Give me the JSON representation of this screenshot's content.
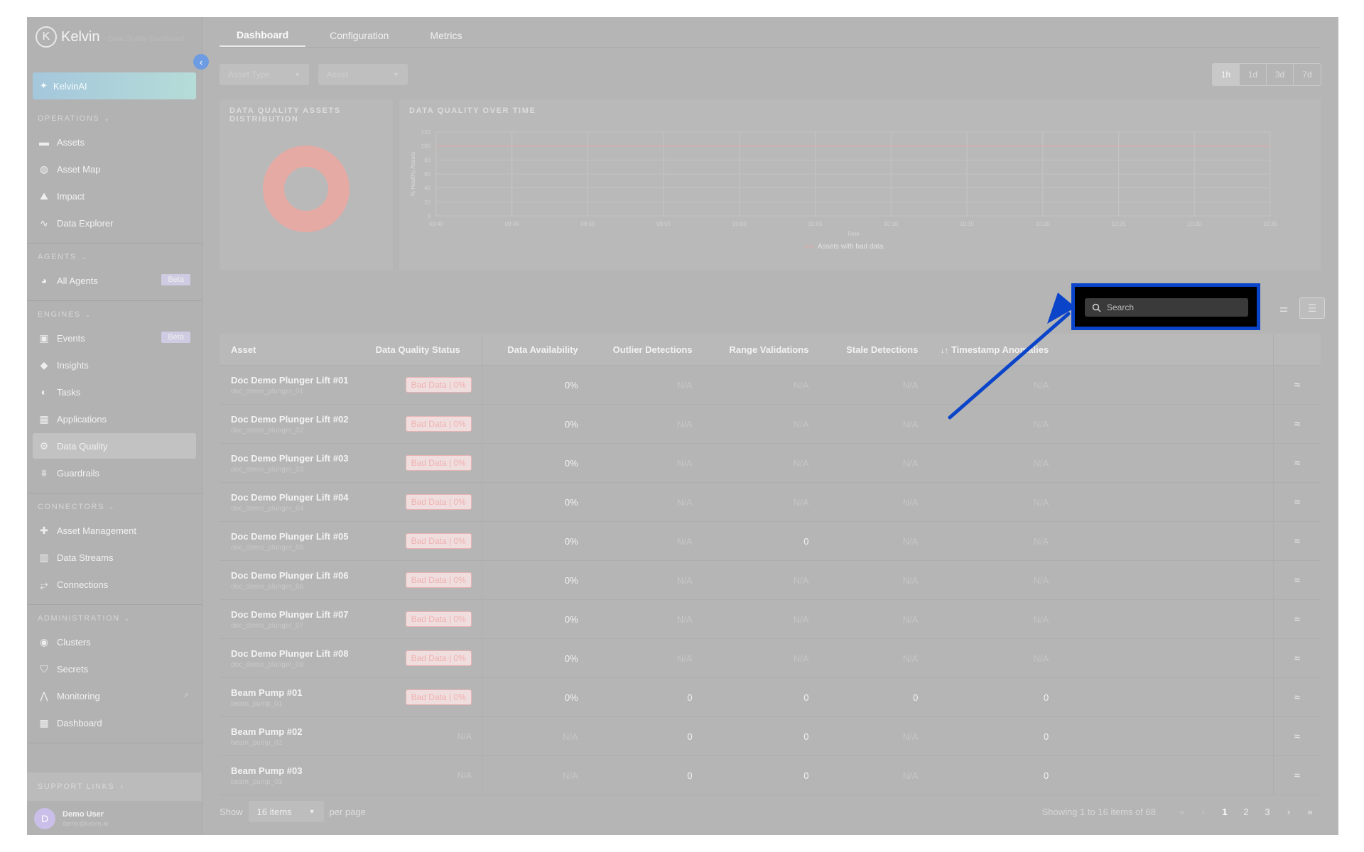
{
  "brand": {
    "name": "Kelvin",
    "subtitle": "Data Quality Dashboard",
    "logo_letter": "K"
  },
  "kelvinai": {
    "label": "KelvinAI"
  },
  "sidebar": {
    "sections": [
      {
        "title": "OPERATIONS",
        "items": [
          {
            "label": "Assets",
            "icon": "assets-icon"
          },
          {
            "label": "Asset Map",
            "icon": "globe-icon"
          },
          {
            "label": "Impact",
            "icon": "impact-icon"
          },
          {
            "label": "Data Explorer",
            "icon": "pulse-icon"
          }
        ]
      },
      {
        "title": "AGENTS",
        "items": [
          {
            "label": "All Agents",
            "icon": "agents-icon",
            "badge": "Beta"
          }
        ]
      },
      {
        "title": "ENGINES",
        "items": [
          {
            "label": "Events",
            "icon": "events-icon",
            "badge": "Beta"
          },
          {
            "label": "Insights",
            "icon": "tag-icon"
          },
          {
            "label": "Tasks",
            "icon": "tasks-icon"
          },
          {
            "label": "Applications",
            "icon": "grid-icon"
          },
          {
            "label": "Data Quality",
            "icon": "gear-icon",
            "active": true
          },
          {
            "label": "Guardrails",
            "icon": "guardrails-icon"
          }
        ]
      },
      {
        "title": "CONNECTORS",
        "items": [
          {
            "label": "Asset Management",
            "icon": "asset-management-icon"
          },
          {
            "label": "Data Streams",
            "icon": "chart-icon"
          },
          {
            "label": "Connections",
            "icon": "connections-icon"
          }
        ]
      },
      {
        "title": "ADMINISTRATION",
        "items": [
          {
            "label": "Clusters",
            "icon": "clusters-icon"
          },
          {
            "label": "Secrets",
            "icon": "shield-icon"
          },
          {
            "label": "Monitoring",
            "icon": "monitoring-icon",
            "external": true
          },
          {
            "label": "Dashboard",
            "icon": "dashboard-icon"
          }
        ]
      }
    ],
    "support_links": "SUPPORT LINKS"
  },
  "user": {
    "initial": "D",
    "name": "Demo User",
    "email": "demo@kelvin.ai"
  },
  "tabs": [
    {
      "label": "Dashboard",
      "active": true
    },
    {
      "label": "Configuration"
    },
    {
      "label": "Metrics"
    }
  ],
  "filters": {
    "asset_type": "Asset Type",
    "asset": "Asset"
  },
  "time_ranges": [
    {
      "label": "1h",
      "active": true
    },
    {
      "label": "1d"
    },
    {
      "label": "3d"
    },
    {
      "label": "7d"
    }
  ],
  "cards": {
    "distribution_title": "DATA QUALITY ASSETS DISTRIBUTION",
    "over_time_title": "DATA QUALITY OVER TIME"
  },
  "chart_data": [
    {
      "type": "pie",
      "title": "DATA QUALITY ASSETS DISTRIBUTION",
      "categories": [
        ""
      ],
      "values": [
        100
      ],
      "colors": [
        "#e6aaa5"
      ]
    },
    {
      "type": "line",
      "title": "DATA QUALITY OVER TIME",
      "xlabel": "Time",
      "ylabel": "% Healthy Assets",
      "x": [
        "09:40",
        "09:45",
        "09:50",
        "09:55",
        "10:00",
        "10:05",
        "10:10",
        "10:15",
        "10:20",
        "10:25",
        "10:30",
        "10:35"
      ],
      "yticks": [
        0,
        20,
        40,
        60,
        80,
        100,
        120
      ],
      "ylim": [
        0,
        120
      ],
      "grid": true,
      "legend": "bottom",
      "series": [
        {
          "name": "Assets with bad data",
          "color": "#dda6a6",
          "values": [
            100,
            100,
            100,
            100,
            100,
            100,
            100,
            100,
            100,
            100,
            100,
            100
          ]
        }
      ]
    }
  ],
  "search": {
    "placeholder": "Search"
  },
  "table": {
    "columns": [
      "Asset",
      "Data Quality Status",
      "Data Availability",
      "Outlier Detections",
      "Range Validations",
      "Stale Detections",
      "Timestamp Anomalies"
    ],
    "sort_icon": "↓↑",
    "rows": [
      {
        "name": "Doc Demo Plunger Lift #01",
        "id": "doc_demo_plunger_01",
        "status": "Bad Data | 0%",
        "availability": "0%",
        "outlier": "N/A",
        "range": "N/A",
        "stale": "N/A",
        "timestamp": "N/A"
      },
      {
        "name": "Doc Demo Plunger Lift #02",
        "id": "doc_demo_plunger_02",
        "status": "Bad Data | 0%",
        "availability": "0%",
        "outlier": "N/A",
        "range": "N/A",
        "stale": "N/A",
        "timestamp": "N/A"
      },
      {
        "name": "Doc Demo Plunger Lift #03",
        "id": "doc_demo_plunger_03",
        "status": "Bad Data | 0%",
        "availability": "0%",
        "outlier": "N/A",
        "range": "N/A",
        "stale": "N/A",
        "timestamp": "N/A"
      },
      {
        "name": "Doc Demo Plunger Lift #04",
        "id": "doc_demo_plunger_04",
        "status": "Bad Data | 0%",
        "availability": "0%",
        "outlier": "N/A",
        "range": "N/A",
        "stale": "N/A",
        "timestamp": "N/A"
      },
      {
        "name": "Doc Demo Plunger Lift #05",
        "id": "doc_demo_plunger_05",
        "status": "Bad Data | 0%",
        "availability": "0%",
        "outlier": "N/A",
        "range": "0",
        "stale": "N/A",
        "timestamp": "N/A"
      },
      {
        "name": "Doc Demo Plunger Lift #06",
        "id": "doc_demo_plunger_06",
        "status": "Bad Data | 0%",
        "availability": "0%",
        "outlier": "N/A",
        "range": "N/A",
        "stale": "N/A",
        "timestamp": "N/A"
      },
      {
        "name": "Doc Demo Plunger Lift #07",
        "id": "doc_demo_plunger_07",
        "status": "Bad Data | 0%",
        "availability": "0%",
        "outlier": "N/A",
        "range": "N/A",
        "stale": "N/A",
        "timestamp": "N/A"
      },
      {
        "name": "Doc Demo Plunger Lift #08",
        "id": "doc_demo_plunger_08",
        "status": "Bad Data | 0%",
        "availability": "0%",
        "outlier": "N/A",
        "range": "N/A",
        "stale": "N/A",
        "timestamp": "N/A"
      },
      {
        "name": "Beam Pump #01",
        "id": "beam_pump_01",
        "status": "Bad Data | 0%",
        "availability": "0%",
        "outlier": "0",
        "range": "0",
        "stale": "0",
        "timestamp": "0"
      },
      {
        "name": "Beam Pump #02",
        "id": "beam_pump_02",
        "status": "N/A",
        "availability": "N/A",
        "outlier": "0",
        "range": "0",
        "stale": "N/A",
        "timestamp": "0"
      },
      {
        "name": "Beam Pump #03",
        "id": "beam_pump_03",
        "status": "N/A",
        "availability": "N/A",
        "outlier": "0",
        "range": "0",
        "stale": "N/A",
        "timestamp": "0"
      }
    ]
  },
  "pagination": {
    "show_label": "Show",
    "per_page_value": "16 items",
    "per_page_label": "per page",
    "info": "Showing 1 to 16 items of 68",
    "pages": [
      "1",
      "2",
      "3"
    ],
    "current_page": "1",
    "first": "«",
    "prev": "‹",
    "next": "›",
    "last": "»"
  },
  "annotation": {
    "color": "#0a44c9"
  }
}
